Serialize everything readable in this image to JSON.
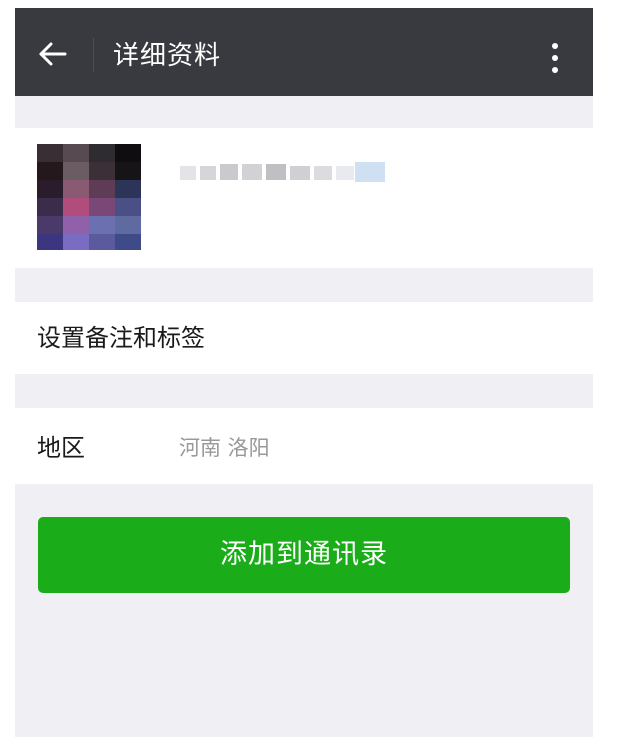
{
  "header": {
    "title": "详细资料",
    "back_icon": "arrow-left-icon",
    "more_icon": "more-vertical-icon",
    "background": "#393a3f"
  },
  "profile": {
    "avatar_icon": "avatar-pixelated",
    "nickname_obscured": true
  },
  "rows": {
    "remark_label": "设置备注和标签",
    "region_label": "地区",
    "region_value": "河南 洛阳"
  },
  "action": {
    "add_button_label": "添加到通讯录",
    "accent_color": "#1aad19"
  }
}
